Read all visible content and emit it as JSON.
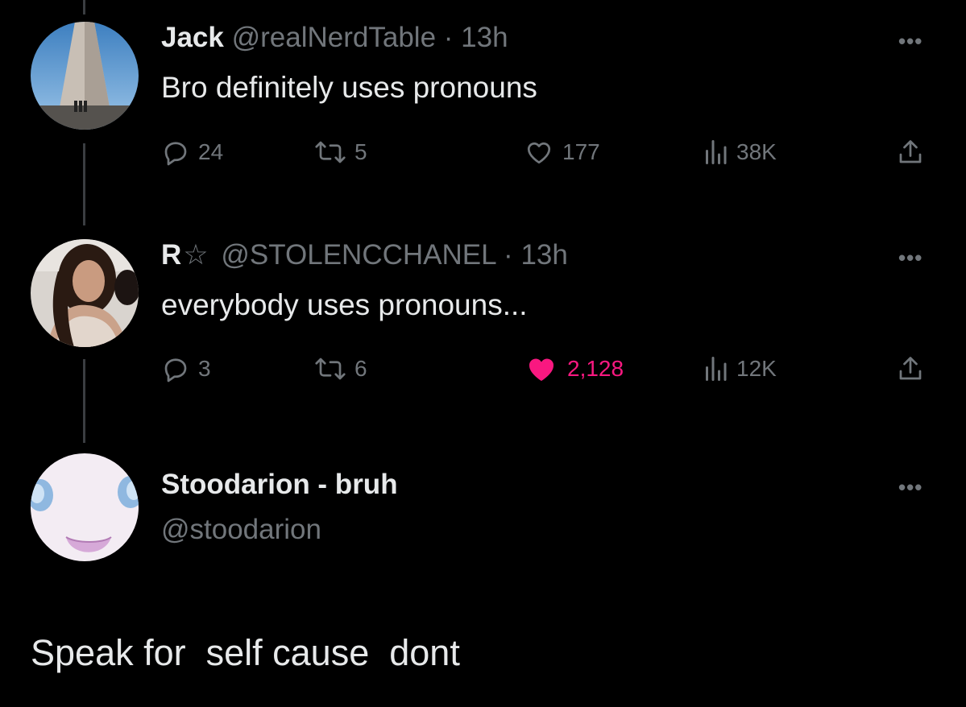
{
  "thread": [
    {
      "name": "Jack",
      "handle": "@realNerdTable",
      "time": "13h",
      "text": "Bro definitely uses pronouns",
      "replies": "24",
      "reposts": "5",
      "likes": "177",
      "views": "38K",
      "liked": false
    },
    {
      "name": "R",
      "badge": "☆",
      "handle": "@STOLENCCHANEL",
      "time": "13h",
      "text": "everybody uses pronouns...",
      "replies": "3",
      "reposts": "6",
      "likes": "2,128",
      "views": "12K",
      "liked": true
    }
  ],
  "composer": {
    "name": "Stoodarion - bruh",
    "handle": "@stoodarion",
    "text": "Speak for  self cause  dont"
  },
  "separator": "·",
  "more_glyph": "•••",
  "icons": [
    "reply-icon",
    "repost-icon",
    "like-icon",
    "views-icon",
    "share-icon",
    "more-icon"
  ],
  "colors": {
    "background": "#000000",
    "text": "#e7e9ea",
    "muted": "#71767b",
    "like": "#f91880"
  }
}
